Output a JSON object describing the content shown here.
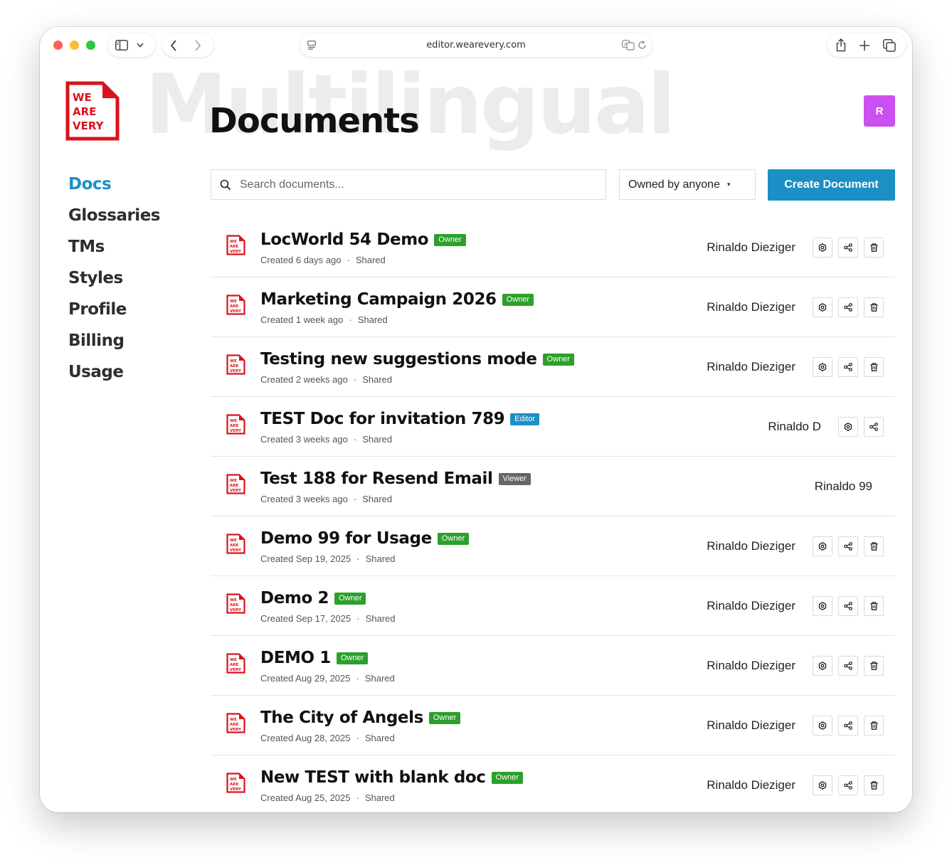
{
  "browser": {
    "url": "editor.wearevery.com"
  },
  "brand": {
    "logo_lines": [
      "WE",
      "ARE",
      "VERY"
    ],
    "watermark": "Multilingual",
    "colors": {
      "accent": "#1a90c4",
      "logo_red": "#d9131c",
      "avatar": "#cc4ff0",
      "owner_badge": "#2ca02c",
      "editor_badge": "#1a90c4",
      "viewer_badge": "#666666"
    }
  },
  "page": {
    "title": "Documents",
    "avatar_initial": "R"
  },
  "nav": {
    "items": [
      {
        "label": "Docs",
        "active": true
      },
      {
        "label": "Glossaries"
      },
      {
        "label": "TMs"
      },
      {
        "label": "Styles"
      },
      {
        "label": "Profile"
      },
      {
        "label": "Billing"
      },
      {
        "label": "Usage"
      }
    ]
  },
  "toolbar": {
    "search_placeholder": "Search documents...",
    "owner_filter": "Owned by anyone",
    "create_label": "Create Document"
  },
  "documents": [
    {
      "title": "LocWorld 54 Demo",
      "role": "Owner",
      "created": "Created 6 days ago",
      "shared": "Shared",
      "owner": "Rinaldo Dieziger",
      "actions": [
        "settings",
        "share",
        "delete"
      ]
    },
    {
      "title": "Marketing Campaign 2026",
      "role": "Owner",
      "created": "Created 1 week ago",
      "shared": "Shared",
      "owner": "Rinaldo Dieziger",
      "actions": [
        "settings",
        "share",
        "delete"
      ]
    },
    {
      "title": "Testing new suggestions mode",
      "role": "Owner",
      "created": "Created 2 weeks ago",
      "shared": "Shared",
      "owner": "Rinaldo Dieziger",
      "actions": [
        "settings",
        "share",
        "delete"
      ]
    },
    {
      "title": "TEST Doc for invitation 789",
      "role": "Editor",
      "created": "Created 3 weeks ago",
      "shared": "Shared",
      "owner": "Rinaldo D",
      "actions": [
        "settings",
        "share"
      ]
    },
    {
      "title": "Test 188 for Resend Email",
      "role": "Viewer",
      "created": "Created 3 weeks ago",
      "shared": "Shared",
      "owner": "Rinaldo 99",
      "actions": []
    },
    {
      "title": "Demo 99 for Usage",
      "role": "Owner",
      "created": "Created Sep 19, 2025",
      "shared": "Shared",
      "owner": "Rinaldo Dieziger",
      "actions": [
        "settings",
        "share",
        "delete"
      ]
    },
    {
      "title": "Demo 2",
      "role": "Owner",
      "created": "Created Sep 17, 2025",
      "shared": "Shared",
      "owner": "Rinaldo Dieziger",
      "actions": [
        "settings",
        "share",
        "delete"
      ]
    },
    {
      "title": "DEMO 1",
      "role": "Owner",
      "created": "Created Aug 29, 2025",
      "shared": "Shared",
      "owner": "Rinaldo Dieziger",
      "actions": [
        "settings",
        "share",
        "delete"
      ]
    },
    {
      "title": "The City of Angels",
      "role": "Owner",
      "created": "Created Aug 28, 2025",
      "shared": "Shared",
      "owner": "Rinaldo Dieziger",
      "actions": [
        "settings",
        "share",
        "delete"
      ]
    },
    {
      "title": "New TEST with blank doc",
      "role": "Owner",
      "created": "Created Aug 25, 2025",
      "shared": "Shared",
      "owner": "Rinaldo Dieziger",
      "actions": [
        "settings",
        "share",
        "delete"
      ]
    }
  ]
}
